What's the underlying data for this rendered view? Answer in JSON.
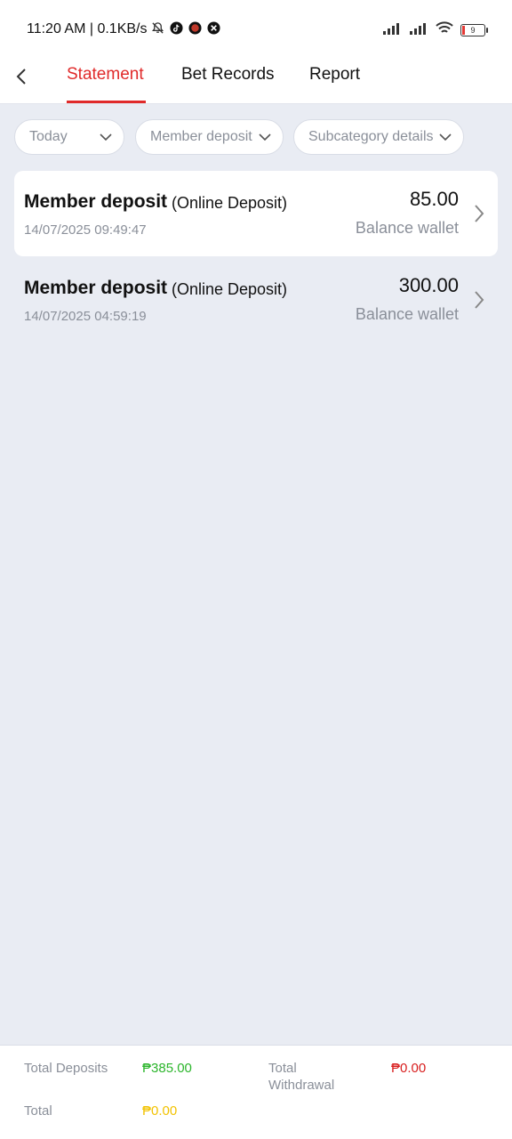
{
  "status_bar": {
    "time": "11:20 AM | 0.1KB/s",
    "battery_level": "9"
  },
  "nav": {
    "tabs": [
      {
        "label": "Statement",
        "active": true
      },
      {
        "label": "Bet Records",
        "active": false
      },
      {
        "label": "Report",
        "active": false
      }
    ]
  },
  "filters": [
    {
      "label": "Today"
    },
    {
      "label": "Member deposit"
    },
    {
      "label": "Subcategory details"
    }
  ],
  "records": [
    {
      "title": "Member deposit",
      "subtitle": "(Online Deposit)",
      "date": "14/07/2025 09:49:47",
      "amount": "85.00",
      "wallet": "Balance wallet"
    },
    {
      "title": "Member deposit",
      "subtitle": "(Online Deposit)",
      "date": "14/07/2025 04:59:19",
      "amount": "300.00",
      "wallet": "Balance wallet"
    }
  ],
  "summary": {
    "total_deposits_label": "Total Deposits",
    "total_deposits_value": "₱385.00",
    "total_withdrawal_label_line1": "Total",
    "total_withdrawal_label_line2": "Withdrawal",
    "total_withdrawal_value": "₱0.00",
    "total_label": "Total",
    "total_value": "₱0.00"
  },
  "colors": {
    "accent": "#e02a2a",
    "deposit_green": "#2bb52b",
    "withdrawal_red": "#d81e1e",
    "total_yellow": "#f2c200",
    "background": "#e9ecf3"
  }
}
